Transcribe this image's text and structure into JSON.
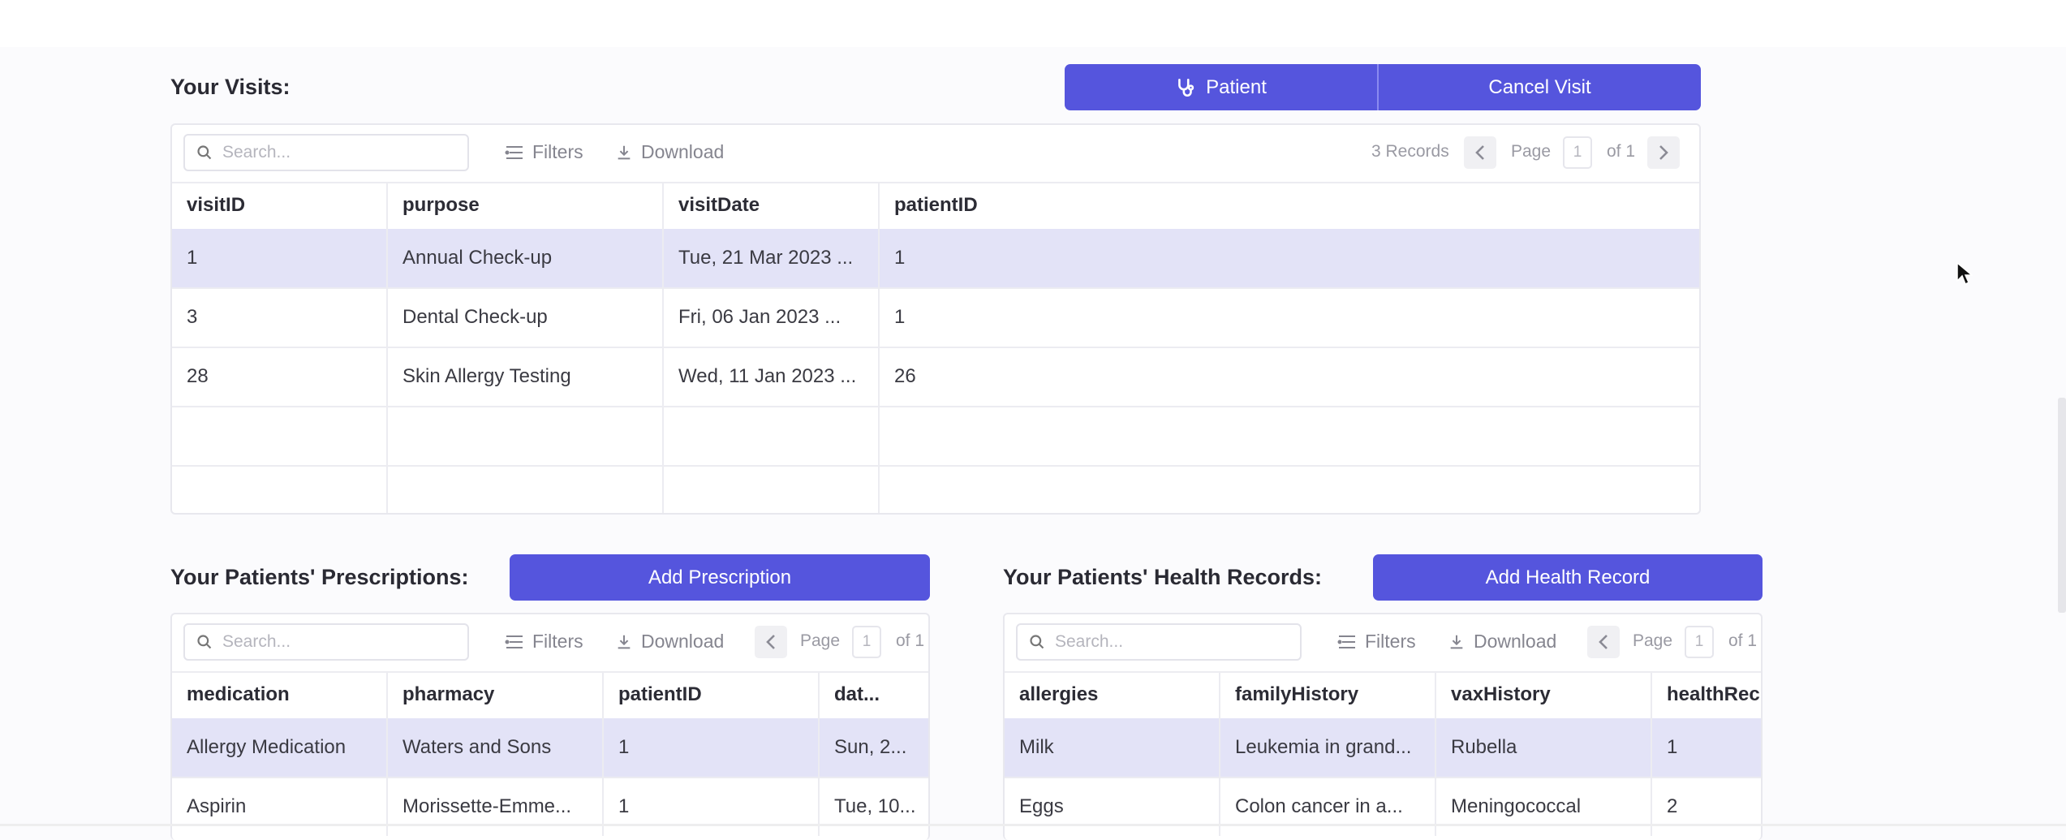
{
  "colors": {
    "accent": "#5555dd",
    "selected_row": "#e3e3f7",
    "background": "#fbfbfd"
  },
  "visits": {
    "title": "Your Visits:",
    "patient_button": "Patient",
    "patient_icon": "stethoscope-icon",
    "cancel_button": "Cancel Visit",
    "search_placeholder": "Search...",
    "filters_label": "Filters",
    "download_label": "Download",
    "records": "3 Records",
    "page_label": "Page",
    "page_value": "1",
    "of_label": "of 1",
    "columns": [
      "visitID",
      "purpose",
      "visitDate",
      "patientID"
    ],
    "rows": [
      [
        "1",
        "Annual Check-up",
        "Tue, 21 Mar 2023 ...",
        "1"
      ],
      [
        "3",
        "Dental Check-up",
        "Fri, 06 Jan 2023 ...",
        "1"
      ],
      [
        "28",
        "Skin Allergy Testing",
        "Wed, 11 Jan 2023 ...",
        "26"
      ]
    ],
    "selected_row": 0
  },
  "prescriptions": {
    "title": "Your Patients' Prescriptions:",
    "add_button": "Add Prescription",
    "search_placeholder": "Search...",
    "filters_label": "Filters",
    "download_label": "Download",
    "page_label": "Page",
    "page_value": "1",
    "of_label": "of 1",
    "columns": [
      "medication",
      "pharmacy",
      "patientID",
      "dat..."
    ],
    "rows": [
      [
        "Allergy Medication",
        "Waters and Sons",
        "1",
        "Sun, 2..."
      ],
      [
        "Aspirin",
        "Morissette-Emme...",
        "1",
        "Tue, 10..."
      ]
    ],
    "selected_row": 0
  },
  "health_records": {
    "title": "Your Patients' Health Records:",
    "add_button": "Add Health Record",
    "search_placeholder": "Search...",
    "filters_label": "Filters",
    "download_label": "Download",
    "page_label": "Page",
    "page_value": "1",
    "of_label": "of 1",
    "columns": [
      "allergies",
      "familyHistory",
      "vaxHistory",
      "healthRec"
    ],
    "rows": [
      [
        "Milk",
        "Leukemia in grand...",
        "Rubella",
        "1"
      ],
      [
        "Eggs",
        "Colon cancer in a...",
        "Meningococcal",
        "2"
      ]
    ],
    "selected_row": 0
  }
}
